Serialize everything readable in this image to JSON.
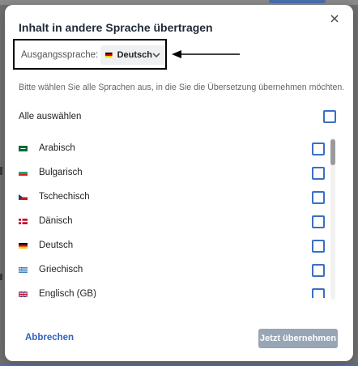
{
  "dialog": {
    "title": "Inhalt in andere Sprache übertragen",
    "source_label": "Ausgangssprache:",
    "source_value": "Deutsch",
    "hint": "Bitte wählen Sie alle Sprachen aus, in die Sie die Übersetzung übernehmen möchten.",
    "select_all_label": "Alle auswählen",
    "languages": [
      {
        "label": "Arabisch",
        "flag_icon": "flag-sa-icon",
        "checked": false
      },
      {
        "label": "Bulgarisch",
        "flag_icon": "flag-bg-icon",
        "checked": false
      },
      {
        "label": "Tschechisch",
        "flag_icon": "flag-cz-icon",
        "checked": false
      },
      {
        "label": "Dänisch",
        "flag_icon": "flag-dk-icon",
        "checked": false
      },
      {
        "label": "Deutsch",
        "flag_icon": "flag-de-icon",
        "checked": false
      },
      {
        "label": "Griechisch",
        "flag_icon": "flag-gr-icon",
        "checked": false
      },
      {
        "label": "Englisch (GB)",
        "flag_icon": "flag-gb-icon",
        "checked": false
      }
    ],
    "cancel_label": "Abbrechen",
    "apply_label": "Jetzt übernehmen"
  },
  "colors": {
    "accent": "#3b6fc4",
    "link": "#2f62c4",
    "apply_disabled": "#98a5b5",
    "highlight_border": "#000000"
  }
}
